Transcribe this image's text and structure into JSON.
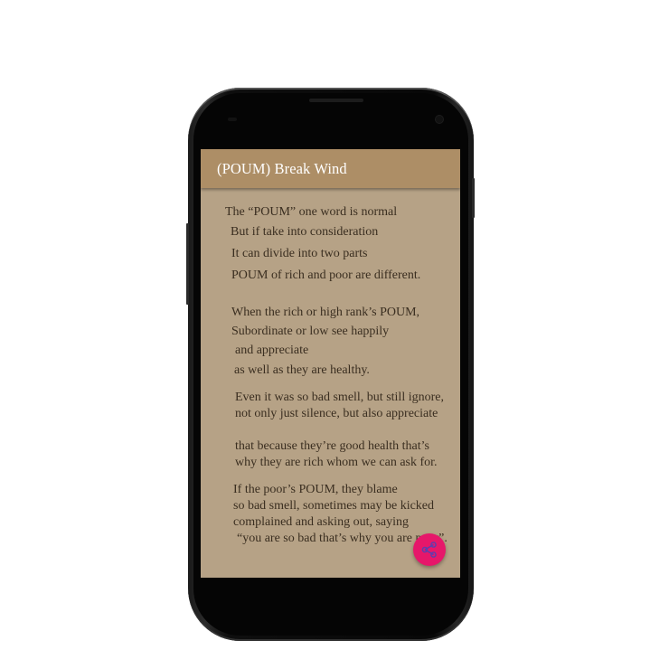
{
  "app": {
    "title": "(POUM) Break Wind"
  },
  "poem": {
    "lines": [
      "The “POUM” one word is normal",
      "But if take into consideration",
      "It can divide into two parts",
      "POUM of rich and poor are different.",
      "When the rich or high rank’s POUM,",
      "Subordinate or low see happily",
      "and appreciate",
      "as well as they are healthy.",
      "Even it was so bad smell, but still ignore,",
      "not only just silence, but also appreciate",
      "that because they’re good health that’s",
      "why they are rich whom we can ask for.",
      "If the poor’s POUM, they blame",
      "so bad smell, sometimes may be kicked",
      "complained and asking out, saying",
      "“you are so bad that’s why you are poor”."
    ]
  },
  "fab": {
    "icon": "share-icon",
    "color": "#e6176a"
  },
  "colors": {
    "appbar": "#ad8e66",
    "background": "#b6a286",
    "text": "#3a2e20"
  }
}
